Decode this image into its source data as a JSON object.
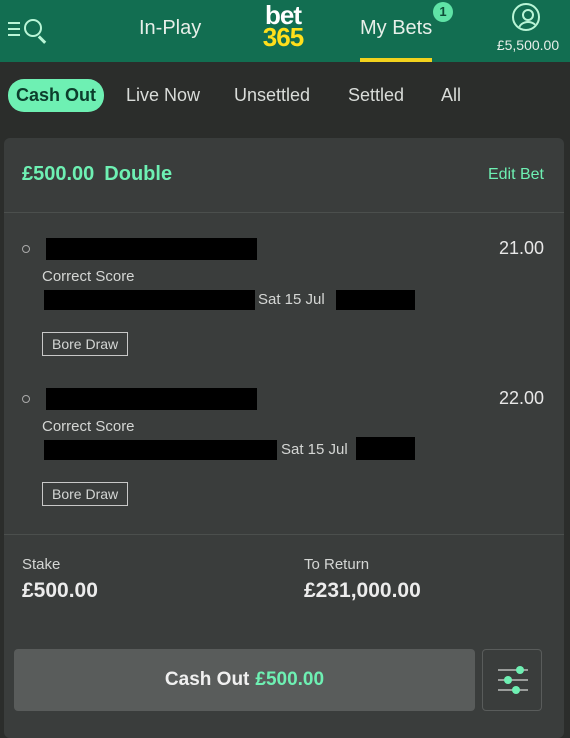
{
  "header": {
    "nav_inplay": "In-Play",
    "logo_top": "bet",
    "logo_bottom": "365",
    "nav_mybets": "My Bets",
    "badge_count": "1",
    "balance": "£5,500.00"
  },
  "tabs": [
    "Cash Out",
    "Live Now",
    "Unsettled",
    "Settled",
    "All"
  ],
  "bet": {
    "stake_amount": "£500.00",
    "bet_type": "Double",
    "edit_label": "Edit Bet",
    "selections": [
      {
        "market": "Correct Score",
        "date": "Sat 15 Jul",
        "score": "Bore Draw",
        "odds": "21.00"
      },
      {
        "market": "Correct Score",
        "date": "Sat 15 Jul",
        "score": "Bore Draw",
        "odds": "22.00"
      }
    ],
    "stake_label": "Stake",
    "stake_value": "£500.00",
    "return_label": "To Return",
    "return_value": "£231,000.00",
    "cashout_label": "Cash Out",
    "cashout_amount": "£500.00"
  },
  "colors": {
    "header_bg": "#126e51",
    "accent": "#6ef0b3",
    "logo_yellow": "#ffdf1b",
    "underline": "#f2d21d"
  },
  "icons": [
    "menu-icon",
    "search-icon",
    "account-icon",
    "settings-sliders-icon"
  ]
}
